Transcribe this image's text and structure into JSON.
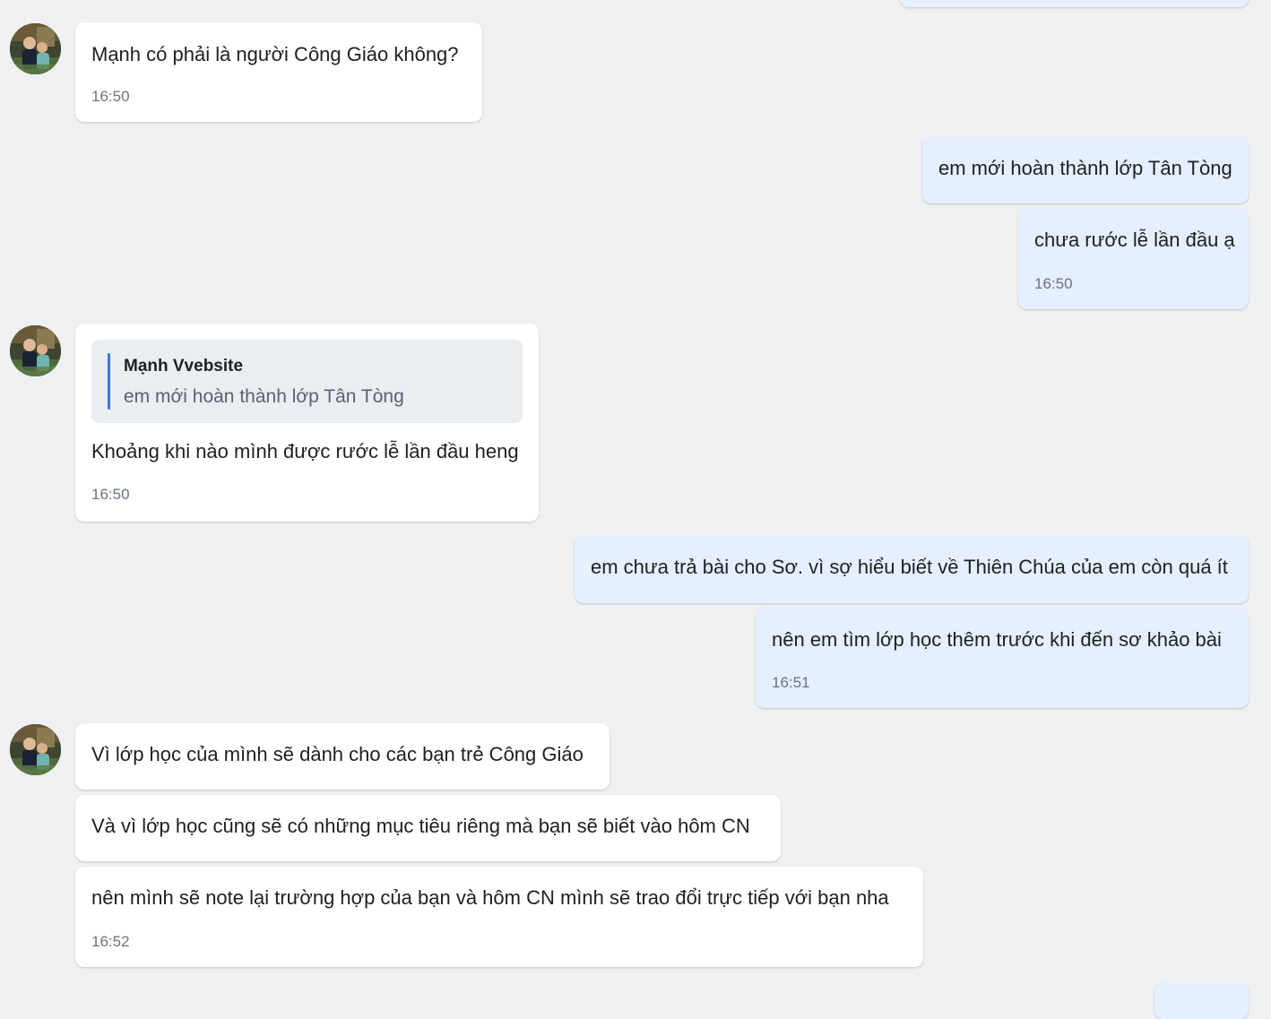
{
  "chat": {
    "contact_avatar": "contact-avatar-photo",
    "messages": [
      {
        "direction": "outgoing",
        "text": "",
        "time": ""
      },
      {
        "direction": "incoming",
        "text": "Mạnh có phải là người Công Giáo không?",
        "time": "16:50"
      },
      {
        "direction": "outgoing",
        "text": "em mới hoàn thành lớp Tân Tòng",
        "time": ""
      },
      {
        "direction": "outgoing",
        "text": "chưa rước lễ lần đầu ạ",
        "time": "16:50"
      },
      {
        "direction": "incoming",
        "quote": {
          "sender": "Mạnh Vvebsite",
          "text": "em mới hoàn thành lớp Tân Tòng"
        },
        "text": "Khoảng khi nào mình được rước lễ lần đầu heng",
        "time": "16:50"
      },
      {
        "direction": "outgoing",
        "text": "em chưa trả bài cho Sơ. vì sợ hiểu biết về Thiên Chúa của em còn quá ít",
        "time": ""
      },
      {
        "direction": "outgoing",
        "text": "nên em tìm lớp học thêm trước khi đến sơ khảo bài",
        "time": "16:51"
      },
      {
        "direction": "incoming",
        "text": "Vì lớp học của mình sẽ dành cho các bạn trẻ Công Giáo",
        "time": ""
      },
      {
        "direction": "incoming",
        "text": "Và vì lớp học cũng sẽ có những mục tiêu riêng mà bạn sẽ biết vào hôm CN",
        "time": ""
      },
      {
        "direction": "incoming",
        "text": "nên mình sẽ note lại trường hợp của bạn và hôm CN mình sẽ trao đổi trực tiếp với bạn nha",
        "time": "16:52"
      }
    ]
  },
  "colors": {
    "background": "#eef0f1",
    "incoming_bubble": "#ffffff",
    "outgoing_bubble": "#e5efff",
    "quote_bar": "#3a7bd5"
  }
}
